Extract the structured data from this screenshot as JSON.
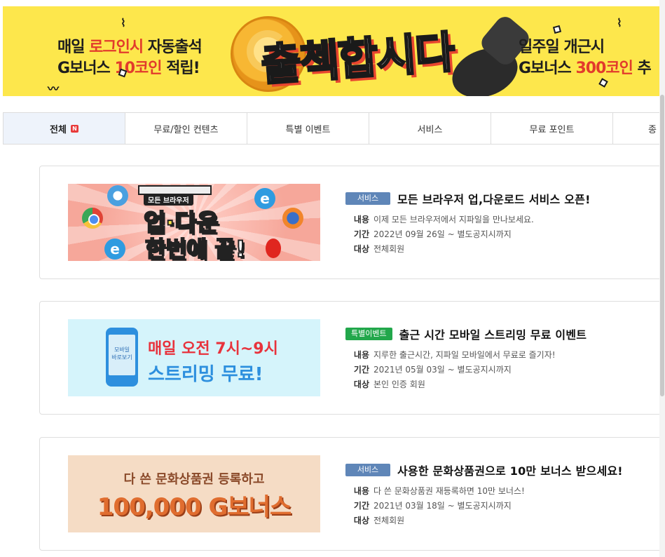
{
  "banner": {
    "left_line1_a": "매일 ",
    "left_line1_red": "로그인시",
    "left_line1_b": " 자동출석",
    "left_line2_a": "G보너스 ",
    "left_line2_hl": "10코인",
    "left_line2_b": " 적립!",
    "headline": "출첵합시다",
    "right_line1": "일주일 개근시",
    "right_line2_a": "G보너스 ",
    "right_line2_hl": "300코인",
    "right_line2_b": " 추"
  },
  "tabs": [
    {
      "label": "전체",
      "badge": "N",
      "active": true
    },
    {
      "label": "무료/할인 컨텐츠"
    },
    {
      "label": "특별 이벤트"
    },
    {
      "label": "서비스"
    },
    {
      "label": "무료 포인트"
    },
    {
      "label": "종"
    }
  ],
  "meta_labels": {
    "content": "내용",
    "period": "기간",
    "target": "대상"
  },
  "events": [
    {
      "category": "서비스",
      "category_color": "#5f86b8",
      "title": "모든 브라우저 업,다운로드 서비스 오픈!",
      "content": "이제 모든 브라우저에서 지파일을 만나보세요.",
      "period": "2022년 09월 26일 ~ 별도공지시까지",
      "target": "전체회원",
      "thumb": {
        "small": "모든 브라우저",
        "big1": "업·다운",
        "big2": "한번에 끝!",
        "ie": "e"
      }
    },
    {
      "category": "특별이벤트",
      "category_color": "#22a74b",
      "title": "출근 시간 모바일 스트리밍 무료 이벤트",
      "content": "지루한 출근시간, 지파일 모바일에서 무료로 즐기자!",
      "period": "2021년 05월 03일 ~ 별도공지시까지",
      "target": "본인 인증 회원",
      "thumb": {
        "phone_text1": "모바일",
        "phone_text2": "바로보기",
        "line1": "매일 오전 7시~9시",
        "line2": "스트리밍 무료!"
      }
    },
    {
      "category": "서비스",
      "category_color": "#5f86b8",
      "title": "사용한 문화상품권으로 10만 보너스 받으세요!",
      "content": "다 쓴 문화상품권 재등록하면 10만 보너스!",
      "period": "2021년 03월 18일 ~ 별도공지시까지",
      "target": "전체회원",
      "thumb": {
        "line1": "다 쓴 문화상품권 등록하고",
        "line2": "100,000 G보너스"
      }
    }
  ]
}
